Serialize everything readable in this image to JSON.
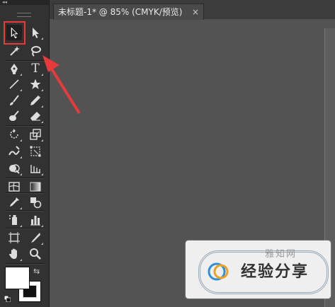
{
  "panel": {
    "collapse_glyph": "◂◂"
  },
  "document_tab": {
    "title": "未标题-1* @ 85% (CMYK/预览)",
    "close_glyph": "×"
  },
  "tools": [
    {
      "name": "selection-tool",
      "icon": "arrow-black-icon",
      "selected": true
    },
    {
      "name": "direct-selection-tool",
      "icon": "arrow-white-icon"
    },
    {
      "name": "magic-wand-tool",
      "icon": "magic-wand-icon"
    },
    {
      "name": "lasso-tool",
      "icon": "lasso-icon"
    },
    {
      "name": "pen-tool",
      "icon": "pen-icon"
    },
    {
      "name": "type-tool",
      "icon": "type-icon",
      "glyph": "T"
    },
    {
      "name": "line-segment-tool",
      "icon": "line-icon"
    },
    {
      "name": "star-tool",
      "icon": "star-icon"
    },
    {
      "name": "paintbrush-tool",
      "icon": "brush-icon"
    },
    {
      "name": "pencil-tool",
      "icon": "pencil-icon"
    },
    {
      "name": "blob-brush-tool",
      "icon": "blob-brush-icon"
    },
    {
      "name": "eraser-tool",
      "icon": "eraser-icon"
    },
    {
      "name": "rotate-tool",
      "icon": "rotate-icon"
    },
    {
      "name": "scale-tool",
      "icon": "scale-icon"
    },
    {
      "name": "warp-tool",
      "icon": "warp-icon"
    },
    {
      "name": "free-transform-tool",
      "icon": "free-transform-icon"
    },
    {
      "name": "shape-builder-tool",
      "icon": "shape-builder-icon"
    },
    {
      "name": "perspective-grid-tool",
      "icon": "perspective-grid-icon"
    },
    {
      "name": "mesh-tool",
      "icon": "mesh-icon"
    },
    {
      "name": "gradient-tool",
      "icon": "gradient-icon"
    },
    {
      "name": "eyedropper-tool",
      "icon": "eyedropper-icon"
    },
    {
      "name": "blend-tool",
      "icon": "blend-icon"
    },
    {
      "name": "symbol-sprayer-tool",
      "icon": "symbol-sprayer-icon"
    },
    {
      "name": "column-graph-tool",
      "icon": "column-graph-icon"
    },
    {
      "name": "artboard-tool",
      "icon": "artboard-icon"
    },
    {
      "name": "slice-tool",
      "icon": "slice-icon"
    },
    {
      "name": "hand-tool",
      "icon": "hand-icon"
    },
    {
      "name": "zoom-tool",
      "icon": "zoom-icon"
    }
  ],
  "colors": {
    "fill": "#ffffff",
    "stroke": "#000000",
    "highlight": "#e83a3a",
    "canvas": "#535353",
    "panel": "#323232"
  },
  "watermark": {
    "top_text": "雅知网",
    "main_text": "经验分享"
  }
}
